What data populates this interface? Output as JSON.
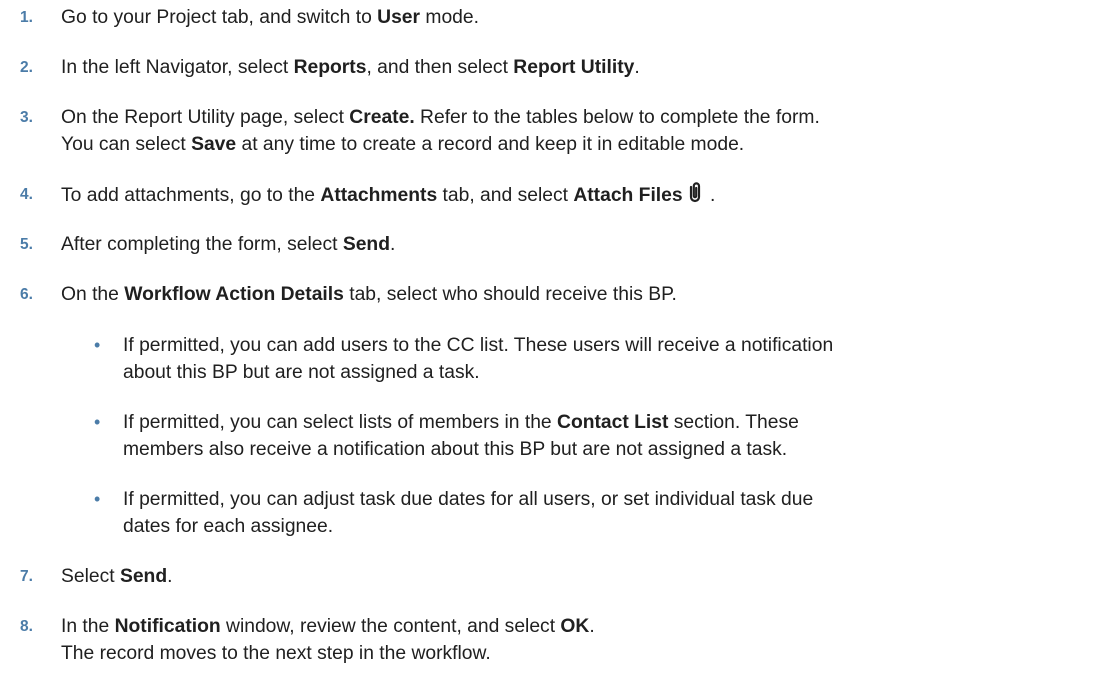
{
  "steps": [
    {
      "n": "1.",
      "a": "Go to your Project tab, and switch to ",
      "b": "User",
      "c": " mode."
    },
    {
      "n": "2.",
      "a": "In the left Navigator, select ",
      "b": "Reports",
      "c": ", and then select ",
      "d": "Report Utility",
      "e": "."
    },
    {
      "n": "3.",
      "a": "On the Report Utility page, select ",
      "b": "Create.",
      "c": " Refer to the tables below to complete the form.",
      "l2a": "You can select ",
      "l2b": "Save",
      "l2c": " at any time to create a record and keep it in editable mode."
    },
    {
      "n": "4.",
      "a": "To add attachments, go to the ",
      "b": "Attachments",
      "c": " tab, and select ",
      "d": "Attach Files",
      "e": " ."
    },
    {
      "n": "5.",
      "a": "After completing the form, select ",
      "b": "Send",
      "c": "."
    },
    {
      "n": "6.",
      "a": "On the ",
      "b": "Workflow Action Details",
      "c": " tab, select who should receive this BP."
    },
    {
      "n": "7.",
      "a": "Select ",
      "b": "Send",
      "c": "."
    },
    {
      "n": "8.",
      "a": "In the ",
      "b": "Notification",
      "c": " window, review the content, and select ",
      "d": "OK",
      "e": ".",
      "l2": "The record moves to the next step in the workflow."
    }
  ],
  "bullets": [
    {
      "l1": "If permitted, you can add users to the CC list. These users will receive a notification",
      "l2": "about this BP but are not assigned a task."
    },
    {
      "l1a": "If permitted, you can select lists of members in the ",
      "l1b": "Contact List",
      "l1c": " section. These",
      "l2": "members also receive a notification about this BP but are not assigned a task."
    },
    {
      "l1": "If permitted, you can adjust task due dates for all users, or set individual task due",
      "l2": "dates for each assignee."
    }
  ],
  "bullet_symbol": "•",
  "colors": {
    "step_number": "#4b7ca8",
    "text": "#202020"
  },
  "icons": {
    "attach_files": "paperclip-icon"
  }
}
